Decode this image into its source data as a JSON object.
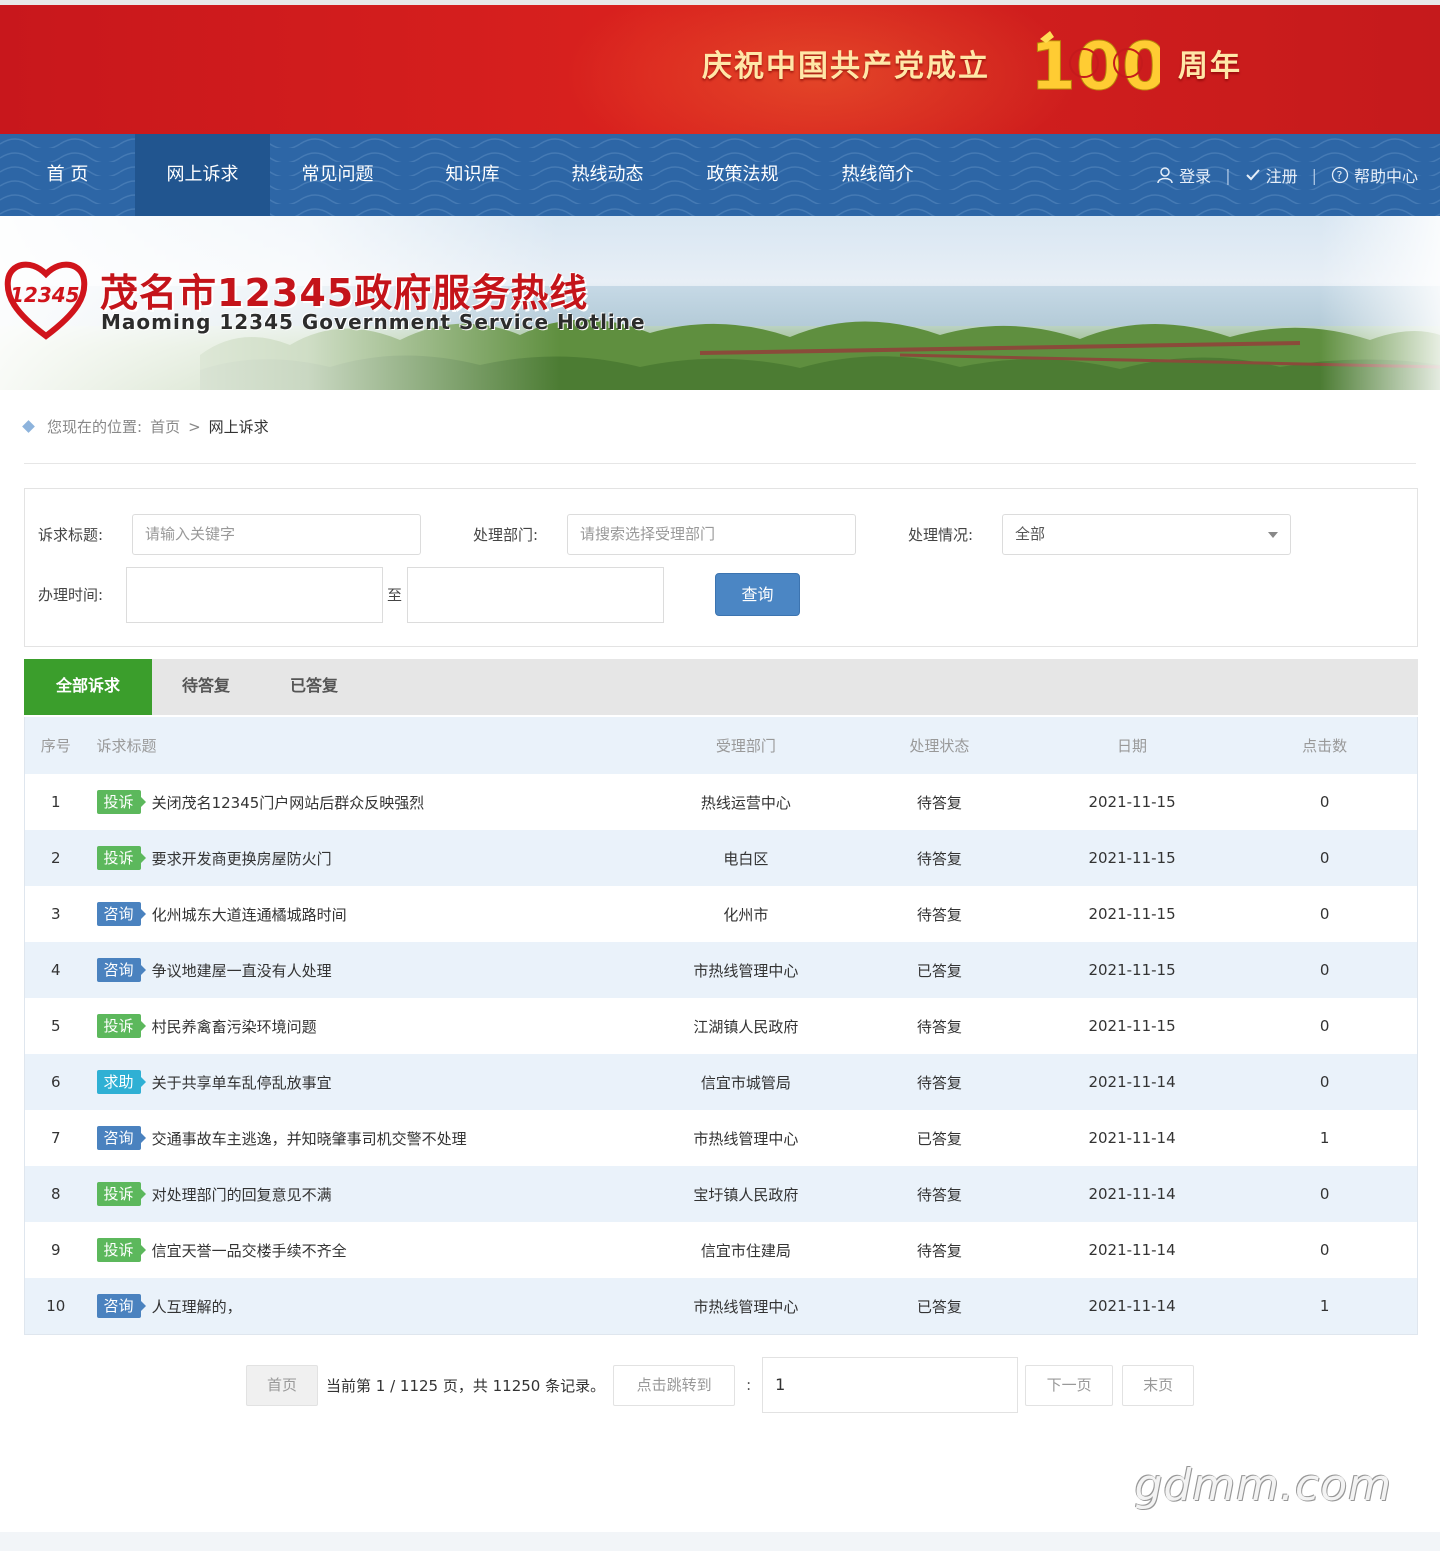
{
  "banner": {
    "celebrate_prefix": "庆祝中国共产党成立",
    "celebrate_number": "100",
    "celebrate_suffix": "周年"
  },
  "nav": {
    "items": [
      "首 页",
      "网上诉求",
      "常见问题",
      "知识库",
      "热线动态",
      "政策法规",
      "热线简介"
    ],
    "active_index": 1,
    "login": "登录",
    "register": "注册",
    "help": "帮助中心"
  },
  "hero": {
    "logo_text": "12345",
    "title": "茂名市12345政府服务热线",
    "subtitle": "Maoming 12345 Government Service Hotline"
  },
  "breadcrumb": {
    "prefix": "您现在的位置:",
    "home": "首页",
    "separator": ">",
    "current": "网上诉求"
  },
  "search": {
    "title_label": "诉求标题:",
    "title_placeholder": "请输入关键字",
    "dept_label": "处理部门:",
    "dept_placeholder": "请搜索选择受理部门",
    "status_label": "处理情况:",
    "status_value": "全部",
    "time_label": "办理时间:",
    "time_to": "至",
    "query_button": "查询"
  },
  "tabs": [
    "全部诉求",
    "待答复",
    "已答复"
  ],
  "table": {
    "headers": {
      "index": "序号",
      "title": "诉求标题",
      "dept": "受理部门",
      "state": "处理状态",
      "date": "日期",
      "clicks": "点击数"
    },
    "rows": [
      {
        "index": "1",
        "type": "投诉",
        "kind": "complaint",
        "title": "关闭茂名12345门户网站后群众反映强烈",
        "dept": "热线运营中心",
        "state": "待答复",
        "date": "2021-11-15",
        "clicks": "0"
      },
      {
        "index": "2",
        "type": "投诉",
        "kind": "complaint",
        "title": "要求开发商更换房屋防火门",
        "dept": "电白区",
        "state": "待答复",
        "date": "2021-11-15",
        "clicks": "0"
      },
      {
        "index": "3",
        "type": "咨询",
        "kind": "consult",
        "title": "化州城东大道连通橘城路时间",
        "dept": "化州市",
        "state": "待答复",
        "date": "2021-11-15",
        "clicks": "0"
      },
      {
        "index": "4",
        "type": "咨询",
        "kind": "consult",
        "title": "争议地建屋一直没有人处理",
        "dept": "市热线管理中心",
        "state": "已答复",
        "date": "2021-11-15",
        "clicks": "0"
      },
      {
        "index": "5",
        "type": "投诉",
        "kind": "complaint",
        "title": "村民养禽畜污染环境问题",
        "dept": "江湖镇人民政府",
        "state": "待答复",
        "date": "2021-11-15",
        "clicks": "0"
      },
      {
        "index": "6",
        "type": "求助",
        "kind": "help",
        "title": "关于共享单车乱停乱放事宜",
        "dept": "信宜市城管局",
        "state": "待答复",
        "date": "2021-11-14",
        "clicks": "0"
      },
      {
        "index": "7",
        "type": "咨询",
        "kind": "consult",
        "title": "交通事故车主逃逸，并知晓肇事司机交警不处理",
        "dept": "市热线管理中心",
        "state": "已答复",
        "date": "2021-11-14",
        "clicks": "1"
      },
      {
        "index": "8",
        "type": "投诉",
        "kind": "complaint",
        "title": "对处理部门的回复意见不满",
        "dept": "宝圩镇人民政府",
        "state": "待答复",
        "date": "2021-11-14",
        "clicks": "0"
      },
      {
        "index": "9",
        "type": "投诉",
        "kind": "complaint",
        "title": "信宜天誉一品交楼手续不齐全",
        "dept": "信宜市住建局",
        "state": "待答复",
        "date": "2021-11-14",
        "clicks": "0"
      },
      {
        "index": "10",
        "type": "咨询",
        "kind": "consult",
        "title": "人互理解的，",
        "dept": "市热线管理中心",
        "state": "已答复",
        "date": "2021-11-14",
        "clicks": "1"
      }
    ]
  },
  "pager": {
    "first": "首页",
    "info": "当前第 1 / 1125 页，共 11250 条记录。",
    "jump_button": "点击跳转到",
    "colon": ":",
    "page_value": "1",
    "next": "下一页",
    "last": "末页"
  },
  "watermark": "gdmm.com",
  "colors": {
    "banner_red": "#d9211e",
    "nav_blue": "#2d66a6",
    "tab_active_green": "#3b9e2c",
    "badge_complaint": "#5cb85c",
    "badge_consult": "#4a82bf",
    "badge_help": "#2fb0d4",
    "query_button": "#4b86c4"
  }
}
